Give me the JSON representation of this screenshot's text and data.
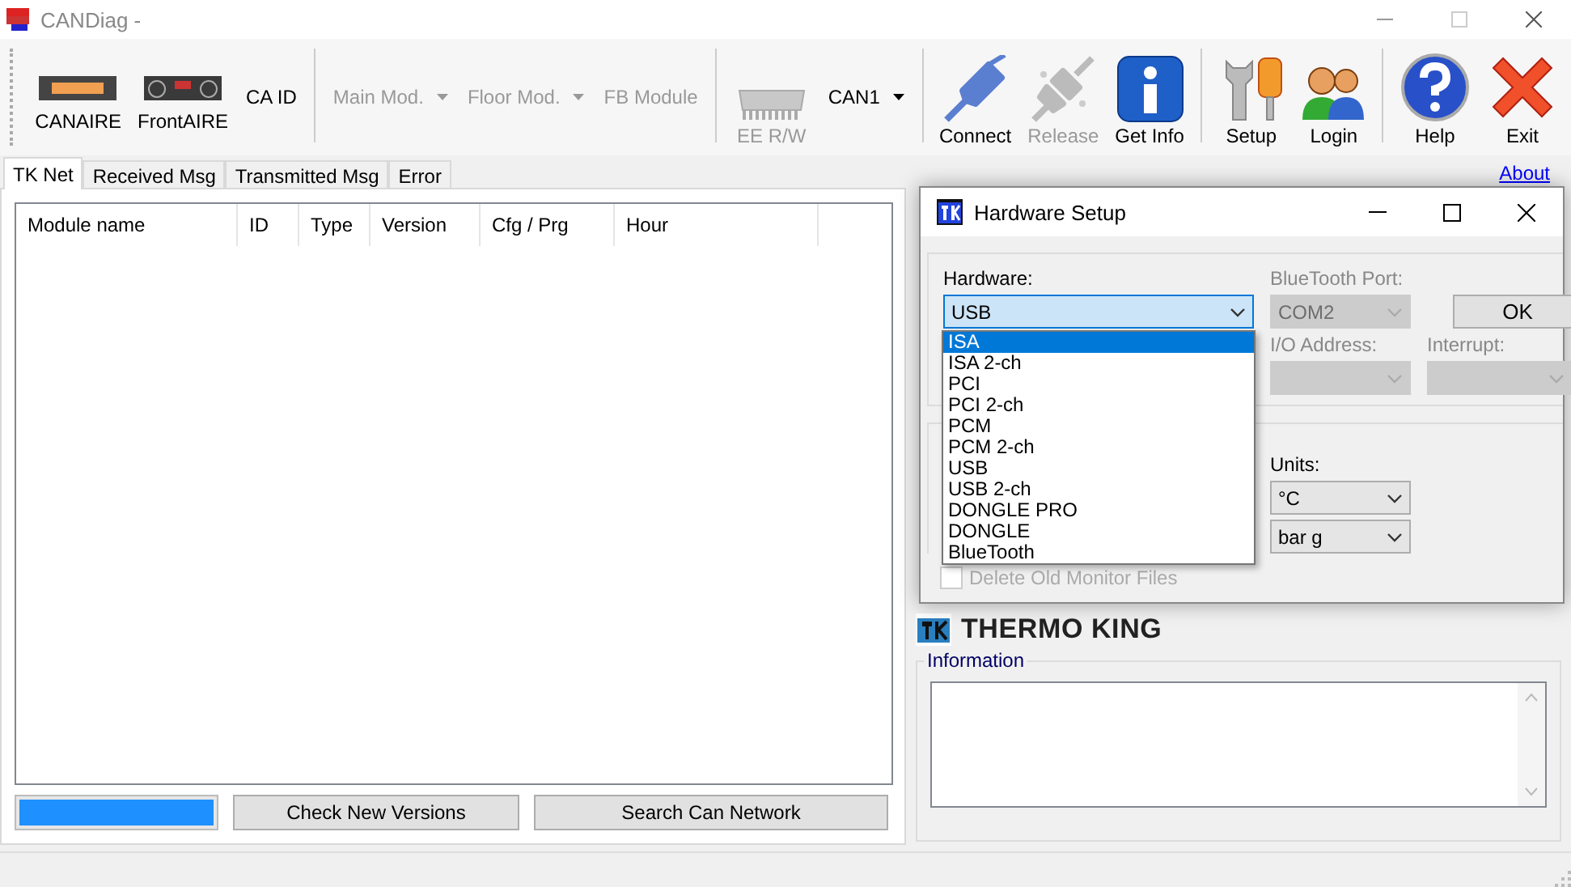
{
  "window": {
    "title": "CANDiag -"
  },
  "toolbar": {
    "groups": [
      {
        "items": [
          {
            "kind": "compact",
            "label": "CANAIRE",
            "disabled": false
          },
          {
            "kind": "compact",
            "label": "FrontAIRE",
            "disabled": false
          },
          {
            "kind": "text",
            "label": "CA ID",
            "disabled": false
          }
        ]
      },
      {
        "items": [
          {
            "kind": "dropdown",
            "label": "Main Mod.",
            "disabled": true
          },
          {
            "kind": "dropdown",
            "label": "Floor Mod.",
            "disabled": true
          },
          {
            "kind": "text",
            "label": "FB Module",
            "disabled": true
          }
        ]
      },
      {
        "items": [
          {
            "kind": "large",
            "label": "EE R/W",
            "disabled": true
          },
          {
            "kind": "dropdown",
            "label": "CAN1",
            "disabled": false
          }
        ]
      },
      {
        "items": [
          {
            "kind": "large",
            "label": "Connect",
            "disabled": false
          },
          {
            "kind": "large",
            "label": "Release",
            "disabled": true
          },
          {
            "kind": "large",
            "label": "Get Info",
            "disabled": false
          }
        ]
      },
      {
        "items": [
          {
            "kind": "large",
            "label": "Setup",
            "disabled": false
          },
          {
            "kind": "large",
            "label": "Login",
            "disabled": false
          }
        ]
      },
      {
        "items": [
          {
            "kind": "large",
            "label": "Help",
            "disabled": false
          },
          {
            "kind": "large",
            "label": "Exit",
            "disabled": false
          }
        ]
      }
    ]
  },
  "tabs": [
    {
      "label": "TK Net",
      "selected": true
    },
    {
      "label": "Received Msg",
      "selected": false
    },
    {
      "label": "Transmitted Msg",
      "selected": false
    },
    {
      "label": "Error",
      "selected": false
    }
  ],
  "about_link": "About",
  "table": {
    "columns": [
      "Module name",
      "ID",
      "Type",
      "Version",
      "Cfg / Prg",
      "Hour"
    ]
  },
  "progress": {
    "level": 1
  },
  "buttons": [
    "Check New Versions",
    "Search Can Network"
  ],
  "logo": "THERMO KING",
  "information": {
    "label": "Information"
  },
  "dialog": {
    "title": "Hardware Setup",
    "hardware": {
      "label": "Hardware:",
      "value": "USB",
      "expanded": true,
      "options": [
        {
          "label": "ISA",
          "highlighted": true
        },
        {
          "label": "ISA 2-ch",
          "highlighted": false
        },
        {
          "label": "PCI",
          "highlighted": false
        },
        {
          "label": "PCI 2-ch",
          "highlighted": false
        },
        {
          "label": "PCM",
          "highlighted": false
        },
        {
          "label": "PCM 2-ch",
          "highlighted": false
        },
        {
          "label": "USB",
          "highlighted": false
        },
        {
          "label": "USB 2-ch",
          "highlighted": false
        },
        {
          "label": "DONGLE PRO",
          "highlighted": false
        },
        {
          "label": "DONGLE",
          "highlighted": false
        },
        {
          "label": "BlueTooth",
          "highlighted": false
        }
      ]
    },
    "bluetooth_port": {
      "label": "BlueTooth Port:",
      "value": "COM2",
      "disabled": true
    },
    "ok_button": "OK",
    "io_address": {
      "label": "I/O Address:",
      "disabled": true
    },
    "interrupt": {
      "label": "Interrupt:",
      "disabled": true
    },
    "units": {
      "label": "Units:",
      "temperature": "°C",
      "pressure": "bar g"
    },
    "delete_old_files": {
      "label": "Delete Old Monitor Files",
      "checked": false,
      "disabled": true
    }
  }
}
